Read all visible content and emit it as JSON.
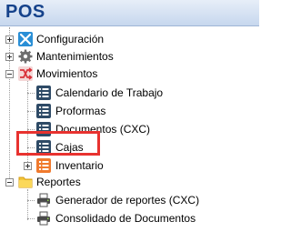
{
  "header": {
    "title": "POS"
  },
  "tree": {
    "configuracion": {
      "label": "Configuración",
      "icon": "wrench-screwdriver-icon",
      "expanded": false
    },
    "mantenimientos": {
      "label": "Mantenimientos",
      "icon": "gear-icon",
      "expanded": false
    },
    "movimientos": {
      "label": "Movimientos",
      "icon": "shuffle-icon",
      "expanded": true,
      "children": {
        "calendario": {
          "label": "Calendario de Trabajo",
          "icon": "list-icon"
        },
        "proformas": {
          "label": "Proformas",
          "icon": "list-icon"
        },
        "documentos": {
          "label": "Documentos (CXC)",
          "icon": "list-icon"
        },
        "cajas": {
          "label": "Cajas",
          "icon": "list-icon",
          "highlighted": true
        },
        "inventario": {
          "label": "Inventario",
          "icon": "list-orange-icon",
          "expanded": false
        }
      }
    },
    "reportes": {
      "label": "Reportes",
      "icon": "folder-icon",
      "expanded": true,
      "children": {
        "generador": {
          "label": "Generador de reportes (CXC)",
          "icon": "printer-icon"
        },
        "consolidado": {
          "label": "Consolidado de Documentos",
          "icon": "printer-icon"
        }
      }
    }
  },
  "colors": {
    "header_text": "#15428b",
    "highlight": "#e8322f",
    "list_icon": "#2e4a66",
    "movimientos_icon": "#d9323a"
  }
}
